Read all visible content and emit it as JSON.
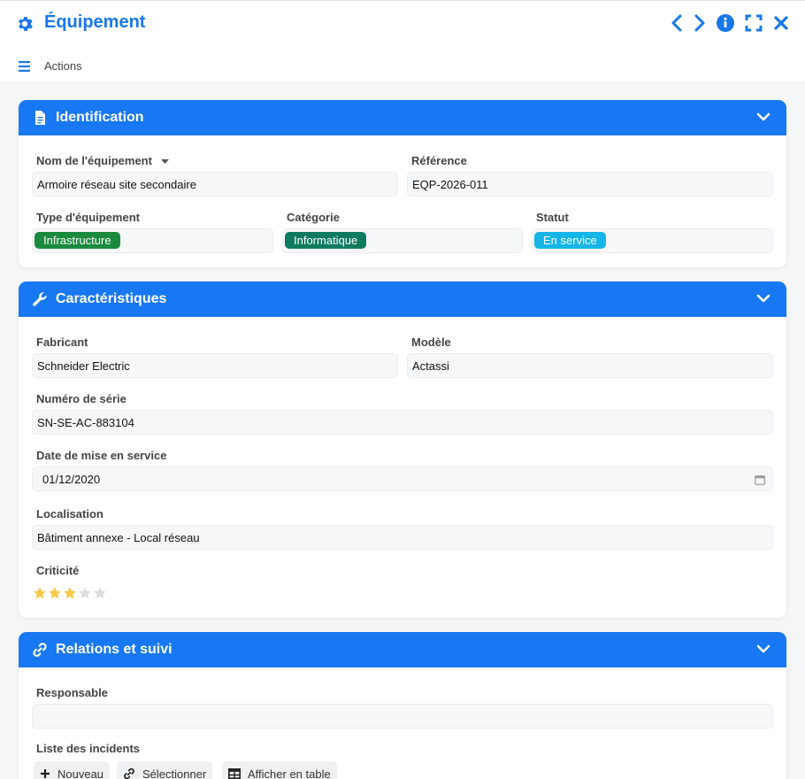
{
  "window": {
    "title": "Équipement",
    "actions_label": "Actions"
  },
  "colors": {
    "accent": "#1877f2",
    "chip_infra": "#1a8a3e",
    "chip_info": "#0f7a5e",
    "chip_status": "#16b5e8",
    "star_on": "#f7c948",
    "star_off": "#dddddd"
  },
  "identification": {
    "title": "Identification",
    "name_label": "Nom de l'équipement",
    "name_value": "Armoire réseau site secondaire",
    "ref_label": "Référence",
    "ref_value": "EQP-2026-011",
    "type_label": "Type d'équipement",
    "type_value": "Infrastructure",
    "cat_label": "Catégorie",
    "cat_value": "Informatique",
    "status_label": "Statut",
    "status_value": "En service"
  },
  "caracteristiques": {
    "title": "Caractéristiques",
    "fab_label": "Fabricant",
    "fab_value": "Schneider Electric",
    "model_label": "Modèle",
    "model_value": "Actassi",
    "serial_label": "Numéro de série",
    "serial_value": "SN-SE-AC-883104",
    "date_label": "Date de mise en service",
    "date_value": "01/12/2020",
    "loc_label": "Localisation",
    "loc_value": "Bâtiment annexe - Local réseau",
    "crit_label": "Criticité",
    "crit_rating": 3,
    "crit_max": 5
  },
  "relations": {
    "title": "Relations et suivi",
    "resp_label": "Responsable",
    "resp_value": "",
    "incidents_label": "Liste des incidents",
    "btn_new": "Nouveau",
    "btn_select": "Sélectionner",
    "btn_table": "Afficher en table"
  }
}
